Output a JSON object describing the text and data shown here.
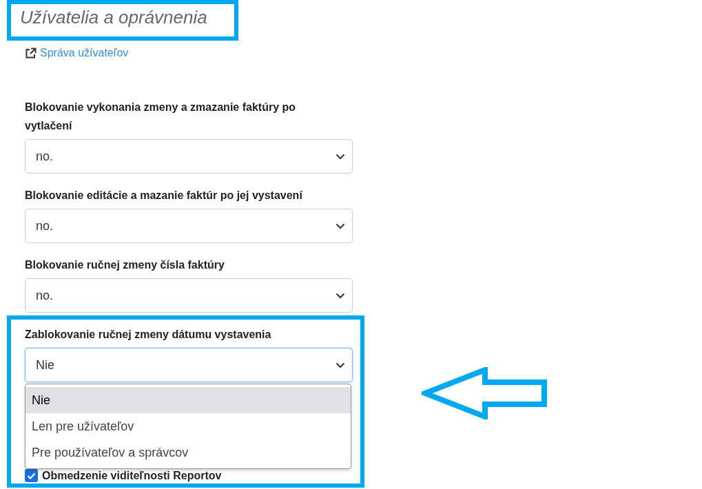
{
  "title": "Užívatelia a oprávnenia",
  "link": {
    "label": "Správa užívateľov"
  },
  "settings": [
    {
      "label": "Blokovanie vykonania zmeny a zmazanie faktúry po vytlačení",
      "value": "no.",
      "open": false
    },
    {
      "label": "Blokovanie editácie a mazanie faktúr po jej vystavení",
      "value": "no.",
      "open": false
    },
    {
      "label": "Blokovanie ručnej zmeny čísla faktúry",
      "value": "no.",
      "open": false
    },
    {
      "label": "Zablokovanie ručnej zmeny dátumu vystavenia",
      "value": "Nie",
      "open": true,
      "options": [
        {
          "label": "Nie",
          "selected": true
        },
        {
          "label": "Len pre užívateľov",
          "selected": false
        },
        {
          "label": "Pre používateľov a správcov",
          "selected": false
        }
      ]
    }
  ],
  "checkbox": {
    "label": "Obmedzenie viditeľnosti Reportov",
    "checked": true
  }
}
